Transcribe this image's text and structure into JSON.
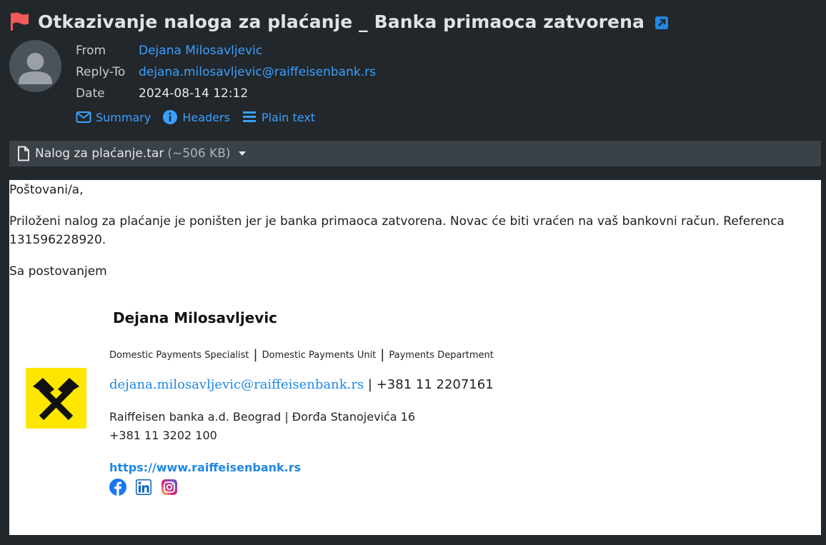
{
  "header": {
    "subject": "Otkazivanje naloga za plaćanje _ Banka primaoca zatvorena",
    "from_label": "From",
    "from_value": "Dejana Milosavljevic",
    "replyto_label": "Reply-To",
    "replyto_value": "dejana.milosavljevic@raiffeisenbank.rs",
    "date_label": "Date",
    "date_value": "2024-08-14 12:12"
  },
  "views": {
    "summary": "Summary",
    "headers": "Headers",
    "plain": "Plain text"
  },
  "attachment": {
    "name": "Nalog za plaćanje.tar",
    "size": "(~506 KB)"
  },
  "body": {
    "greeting": "Poštovani/a,",
    "paragraph1": "Priloženi nalog za plaćanje je poništen jer je banka primaoca zatvorena. Novac će biti vraćen na vaš bankovni račun. Referenca",
    "paragraph2": "131596228920.",
    "closing": "Sa postovanjem"
  },
  "signature": {
    "name": "Dejana Milosavljevic",
    "role1": "Domestic Payments Specialist",
    "role2": "Domestic Payments Unit",
    "role3": "Payments Department",
    "email": "dejana.milosavljevic@raiffeisenbank.rs",
    "phone_mobile": "| +381 11 2207161",
    "address": "Raiffeisen banka a.d. Beograd | Đorđa Stanojevića 16",
    "phone_office": "+381 11 3202 100",
    "website": "https://www.raiffeisenbank.rs"
  },
  "colors": {
    "accent": "#3aa0ff",
    "flag": "#f05a5a",
    "logo_yellow": "#ffe600"
  },
  "icons": [
    "flag-icon",
    "external-link-icon",
    "avatar-icon",
    "envelope-icon",
    "info-icon",
    "list-icon",
    "file-icon",
    "caret-down-icon",
    "raiffeisen-logo",
    "facebook-icon",
    "linkedin-icon",
    "instagram-icon"
  ]
}
